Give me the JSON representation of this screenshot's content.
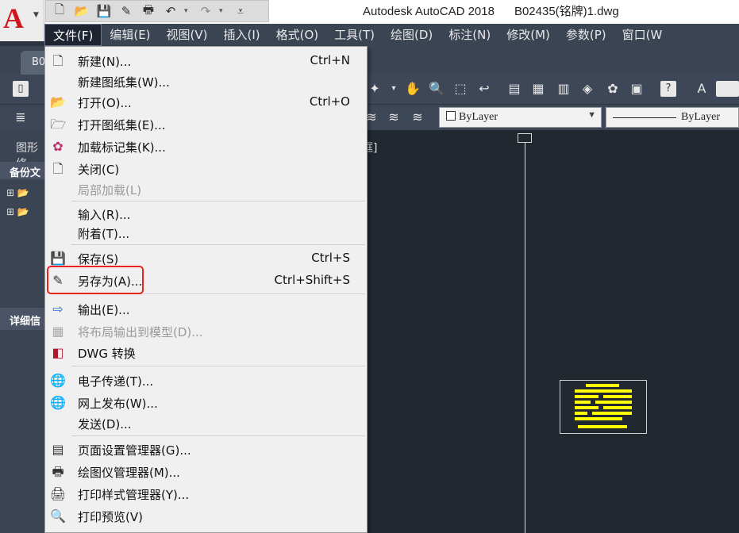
{
  "titlebar": {
    "title": "Autodesk AutoCAD 2018      B02435(铭牌)1.dwg",
    "app_logo": "A",
    "quick_access_icons": [
      "new-icon",
      "open-icon",
      "save-icon",
      "saveas-icon",
      "print-icon",
      "undo-icon",
      "redo-icon"
    ]
  },
  "menubar": {
    "items": [
      {
        "label": "文件(F)"
      },
      {
        "label": "编辑(E)"
      },
      {
        "label": "视图(V)"
      },
      {
        "label": "插入(I)"
      },
      {
        "label": "格式(O)"
      },
      {
        "label": "工具(T)"
      },
      {
        "label": "绘图(D)"
      },
      {
        "label": "标注(N)"
      },
      {
        "label": "修改(M)"
      },
      {
        "label": "参数(P)"
      },
      {
        "label": "窗口(W"
      }
    ]
  },
  "tab": {
    "label": "B0"
  },
  "properties": {
    "layer": "ByLayer",
    "linetype": "ByLayer"
  },
  "left_panel": {
    "header": "图形修",
    "backup_label": "备份文",
    "details_label": "详细信"
  },
  "canvas": {
    "viewport_label": "框]"
  },
  "file_menu": {
    "items": [
      {
        "label": "新建(N)...",
        "shortcut": "Ctrl+N",
        "icon": "new-file-icon",
        "enabled": true
      },
      {
        "label": "新建图纸集(W)...",
        "shortcut": "",
        "icon": "",
        "enabled": true
      },
      {
        "label": "打开(O)...",
        "shortcut": "Ctrl+O",
        "icon": "open-folder-icon",
        "enabled": true
      },
      {
        "label": "打开图纸集(E)...",
        "shortcut": "",
        "icon": "open-sheetset-icon",
        "enabled": true
      },
      {
        "label": "加载标记集(K)...",
        "shortcut": "",
        "icon": "markup-set-icon",
        "enabled": true
      },
      {
        "label": "关闭(C)",
        "shortcut": "",
        "icon": "close-file-icon",
        "enabled": true
      },
      {
        "label": "局部加载(L)",
        "shortcut": "",
        "icon": "",
        "enabled": false
      },
      {
        "label": "输入(R)...",
        "shortcut": "",
        "icon": "",
        "enabled": true
      },
      {
        "label": "附着(T)...",
        "shortcut": "",
        "icon": "",
        "enabled": true
      },
      {
        "label": "保存(S)",
        "shortcut": "Ctrl+S",
        "icon": "save-icon",
        "enabled": true
      },
      {
        "label": "另存为(A)...",
        "shortcut": "Ctrl+Shift+S",
        "icon": "save-as-icon",
        "enabled": true
      },
      {
        "label": "输出(E)...",
        "shortcut": "",
        "icon": "export-icon",
        "enabled": true
      },
      {
        "label": "将布局输出到模型(D)...",
        "shortcut": "",
        "icon": "layout-to-model-icon",
        "enabled": false
      },
      {
        "label": "DWG 转换",
        "shortcut": "",
        "icon": "dwg-convert-icon",
        "enabled": true
      },
      {
        "label": "电子传递(T)...",
        "shortcut": "",
        "icon": "etransmit-icon",
        "enabled": true
      },
      {
        "label": "网上发布(W)...",
        "shortcut": "",
        "icon": "publish-web-icon",
        "enabled": true
      },
      {
        "label": "发送(D)...",
        "shortcut": "",
        "icon": "",
        "enabled": true
      },
      {
        "label": "页面设置管理器(G)...",
        "shortcut": "",
        "icon": "page-setup-icon",
        "enabled": true
      },
      {
        "label": "绘图仪管理器(M)...",
        "shortcut": "",
        "icon": "plotter-icon",
        "enabled": true
      },
      {
        "label": "打印样式管理器(Y)...",
        "shortcut": "",
        "icon": "plot-style-icon",
        "enabled": true
      },
      {
        "label": "打印预览(V)",
        "shortcut": "",
        "icon": "print-preview-icon",
        "enabled": true
      }
    ]
  }
}
